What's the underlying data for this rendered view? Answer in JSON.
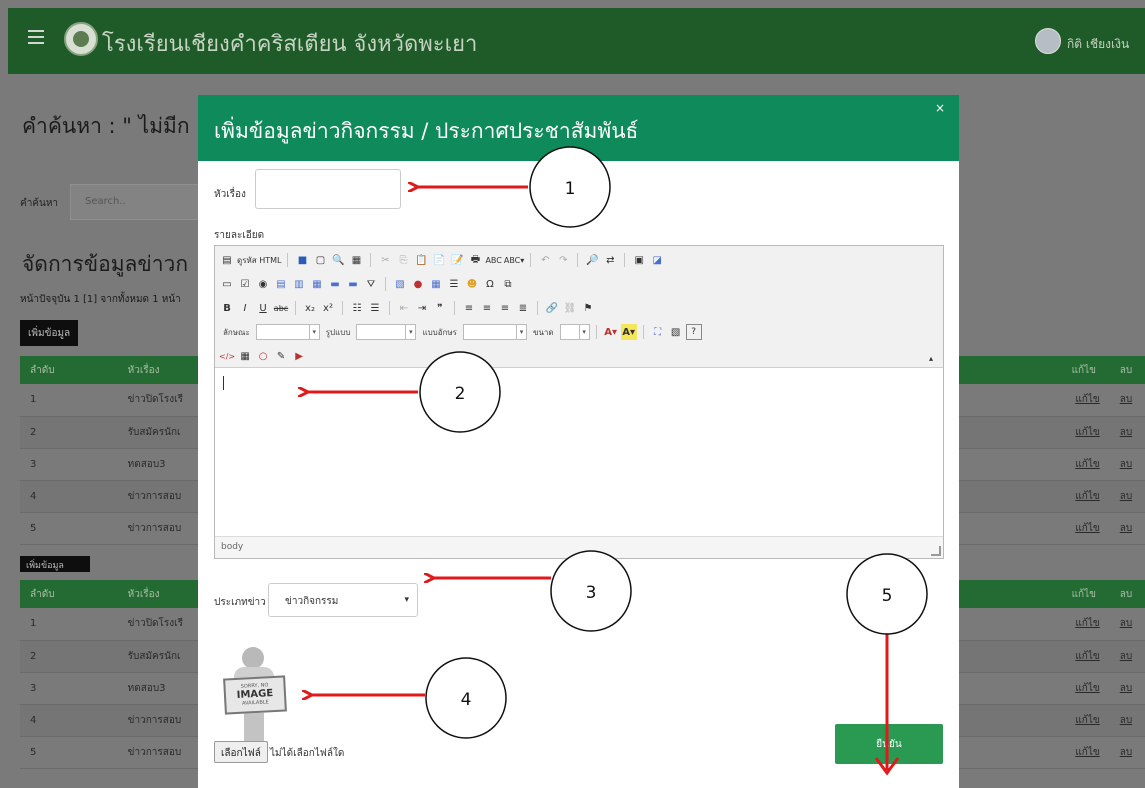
{
  "header": {
    "site_title": "โรงเรียนเชียงคำคริสเตียน จังหวัดพะเยา",
    "user_name": "กิติ เชียงเงิน"
  },
  "search": {
    "heading": "คำค้นหา : \" ไม่มีก",
    "label": "คำค้นหา",
    "placeholder": "Search.."
  },
  "manage": {
    "heading": "จัดการข้อมูลข่าวก",
    "page_info": "หน้าปัจจุบัน 1 [1] จากทั้งหมด 1 หน้า",
    "add_label": "เพิ่มข้อมูล",
    "add_label2": "เพิ่มข้อมูล"
  },
  "table": {
    "headers": {
      "no": "ลำดับ",
      "title": "หัวเรื่อง",
      "edit": "แก้ไข",
      "del": "ลบ"
    },
    "rows": [
      {
        "no": "1",
        "title": "ข่าวปิดโรงเรี",
        "edit": "แก้ไข",
        "del": "ลบ"
      },
      {
        "no": "2",
        "title": "รับสมัครนักเ",
        "edit": "แก้ไข",
        "del": "ลบ"
      },
      {
        "no": "3",
        "title": "ทดสอบ3",
        "edit": "แก้ไข",
        "del": "ลบ"
      },
      {
        "no": "4",
        "title": "ข่าวการสอบ",
        "edit": "แก้ไข",
        "del": "ลบ"
      },
      {
        "no": "5",
        "title": "ข่าวการสอบ",
        "edit": "แก้ไข",
        "del": "ลบ"
      }
    ],
    "rows2": [
      {
        "no": "1",
        "title": "ข่าวปิดโรงเรี",
        "edit": "แก้ไข",
        "del": "ลบ"
      },
      {
        "no": "2",
        "title": "รับสมัครนักเ",
        "edit": "แก้ไข",
        "del": "ลบ"
      },
      {
        "no": "3",
        "title": "ทดสอบ3",
        "edit": "แก้ไข",
        "del": "ลบ"
      },
      {
        "no": "4",
        "title": "ข่าวการสอบ",
        "edit": "แก้ไข",
        "del": "ลบ"
      },
      {
        "no": "5",
        "title": "ข่าวการสอบ",
        "edit": "แก้ไข",
        "del": "ลบ"
      }
    ]
  },
  "modal": {
    "title": "เพิ่มข้อมูลข่าวกิจกรรม / ประกาศประชาสัมพันธ์",
    "close": "×",
    "subject_label": "หัวเรื่อง",
    "detail_label": "รายละเอียด",
    "editor": {
      "source_label": "ดูรหัส HTML",
      "style_label": "ลักษณะ",
      "format_label": "รูปแบบ",
      "font_label": "แบบอักษร",
      "size_label": "ขนาด",
      "footer_path": "body"
    },
    "news_type_label": "ประเภทข่าว",
    "news_type_value": "ข่าวกิจกรรม",
    "placeholder_image": {
      "small": "SORRY, NO",
      "big": "IMAGE",
      "sub": "AVAILABLE"
    },
    "file_button": "เลือกไฟล์",
    "file_status": "ไม่ได้เลือกไฟล์ใด",
    "confirm": "ยืนยัน"
  },
  "annotations": {
    "labels": [
      "1",
      "2",
      "3",
      "4",
      "5"
    ],
    "color": "#e0191b"
  }
}
